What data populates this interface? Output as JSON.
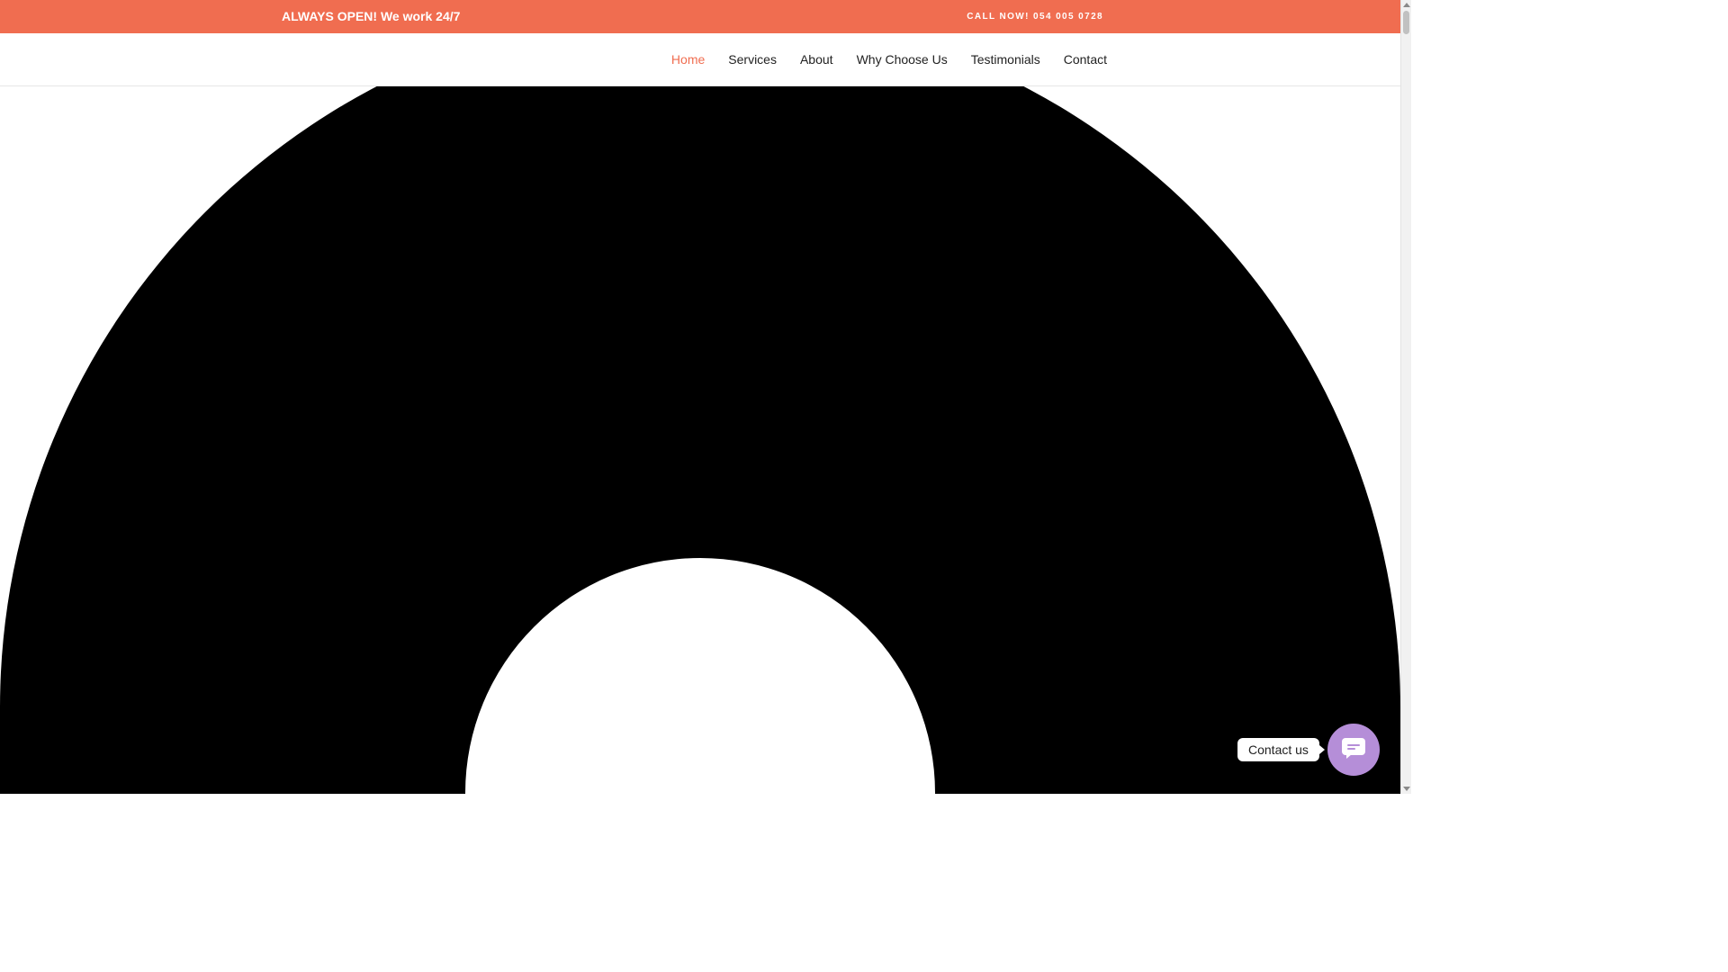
{
  "topbar": {
    "left_text": "ALWAYS OPEN! We work 24/7",
    "right_text": "CALL NOW! 054 005 0728"
  },
  "nav": {
    "items": [
      {
        "label": "Home",
        "active": true
      },
      {
        "label": "Services",
        "active": false
      },
      {
        "label": "About",
        "active": false
      },
      {
        "label": "Why Choose Us",
        "active": false
      },
      {
        "label": "Testimonials",
        "active": false
      },
      {
        "label": "Contact",
        "active": false
      }
    ]
  },
  "hero": {
    "graphic_icon": "black-ring-graphic"
  },
  "contact_widget": {
    "label": "Contact us",
    "icon": "chat-bubble-icon"
  },
  "colors": {
    "accent": "#f06d50",
    "widget": "#b58ed8",
    "graphic": "#000000"
  }
}
